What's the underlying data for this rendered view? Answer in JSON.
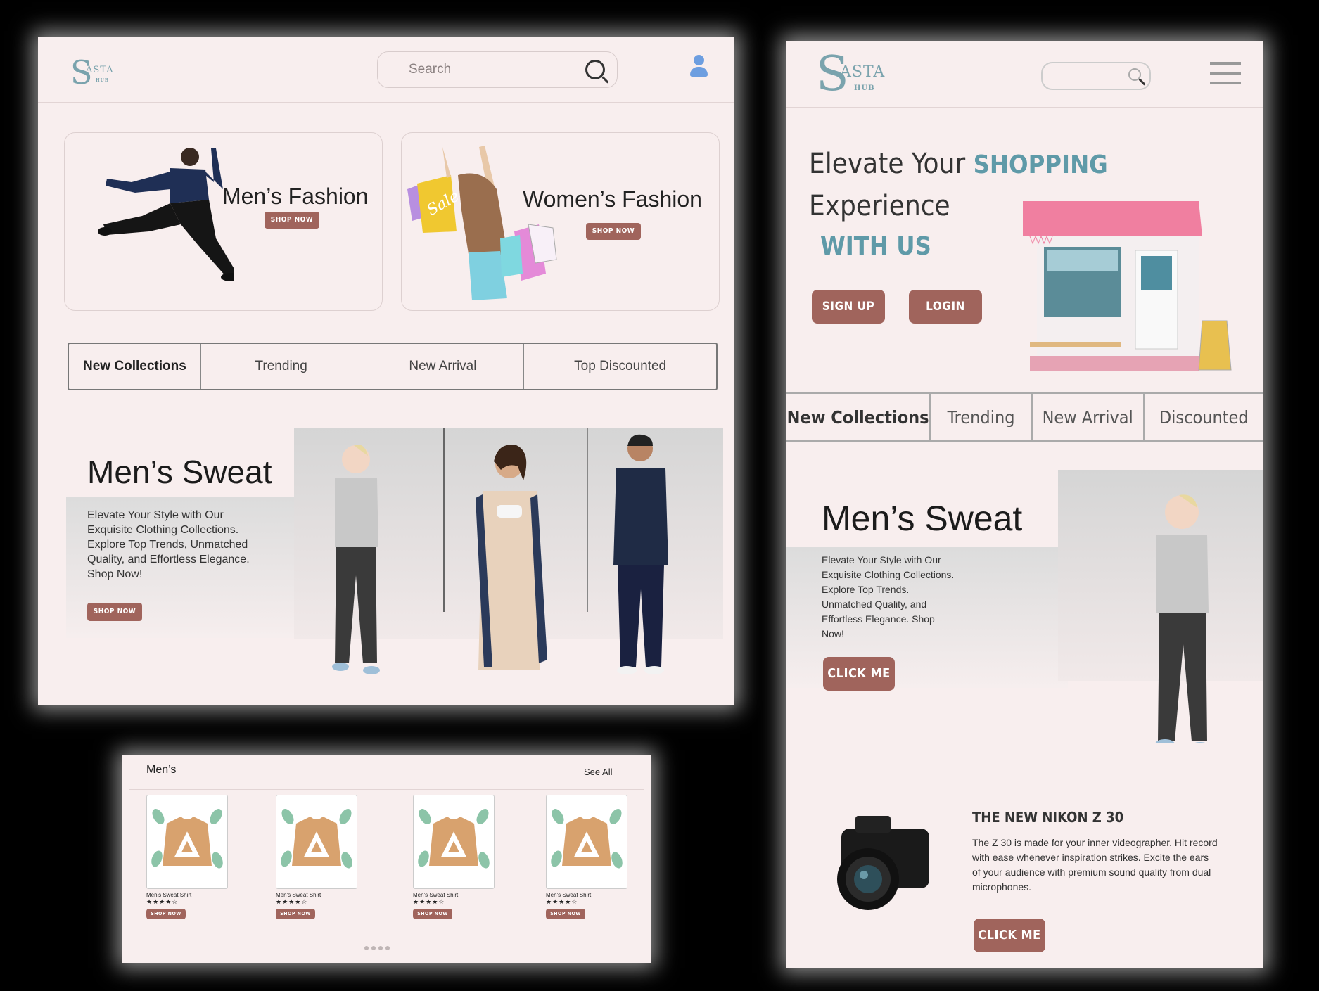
{
  "colors": {
    "accent": "#a0645c",
    "background": "#f8eeee",
    "teal": "#5f9aa8",
    "frame": "#000000"
  },
  "desktop": {
    "logo": {
      "mark": "S",
      "text": "ASTA",
      "sub": "HUB"
    },
    "search_placeholder": "Search",
    "categories": [
      {
        "title": "Men’s Fashion",
        "button": "SHOP NOW"
      },
      {
        "title": "Women’s Fashion",
        "button": "SHOP NOW",
        "bag_text": "Sale"
      }
    ],
    "tabs": [
      "New Collections",
      "Trending",
      "New Arrival",
      "Top Discounted"
    ],
    "hero": {
      "title": "Men’s Sweat",
      "description": "Elevate Your Style with Our Exquisite Clothing Collections. Explore Top Trends, Unmatched Quality, and Effortless Elegance. Shop Now!",
      "button": "SHOP NOW"
    }
  },
  "products": {
    "section_title": "Men’s",
    "see_all": "See All",
    "items": [
      {
        "name": "Men's Sweat Shirt",
        "rating": "★★★★☆",
        "button": "SHOP NOW"
      },
      {
        "name": "Men's Sweat Shirt",
        "rating": "★★★★☆",
        "button": "SHOP NOW"
      },
      {
        "name": "Men's Sweat Shirt",
        "rating": "★★★★☆",
        "button": "SHOP NOW"
      },
      {
        "name": "Men's Sweat Shirt",
        "rating": "★★★★☆",
        "button": "SHOP NOW"
      }
    ],
    "pager_dots": 4
  },
  "mobile": {
    "logo": {
      "mark": "S",
      "text": "ASTA",
      "sub": "HUB"
    },
    "headline": {
      "line1": "Elevate Your",
      "highlight": "SHOPPING",
      "line2": "Experience",
      "line3": "WITH US"
    },
    "buttons": {
      "signup": "SIGN UP",
      "login": "LOGIN"
    },
    "tabs": [
      "New Collections",
      "Trending",
      "New Arrival",
      "Discounted"
    ],
    "hero": {
      "title": "Men’s Sweat",
      "description": "Elevate Your Style with Our Exquisite Clothing Collections. Explore Top Trends. Unmatched Quality, and Effortless Elegance. Shop Now!",
      "button": "CLICK ME"
    },
    "promo": {
      "title": "THE NEW NIKON Z 30",
      "description": "The Z 30 is made for your inner videographer. Hit record with ease whenever inspiration strikes. Excite the ears of your audience with premium sound quality from dual microphones.",
      "button": "CLICK ME"
    }
  }
}
